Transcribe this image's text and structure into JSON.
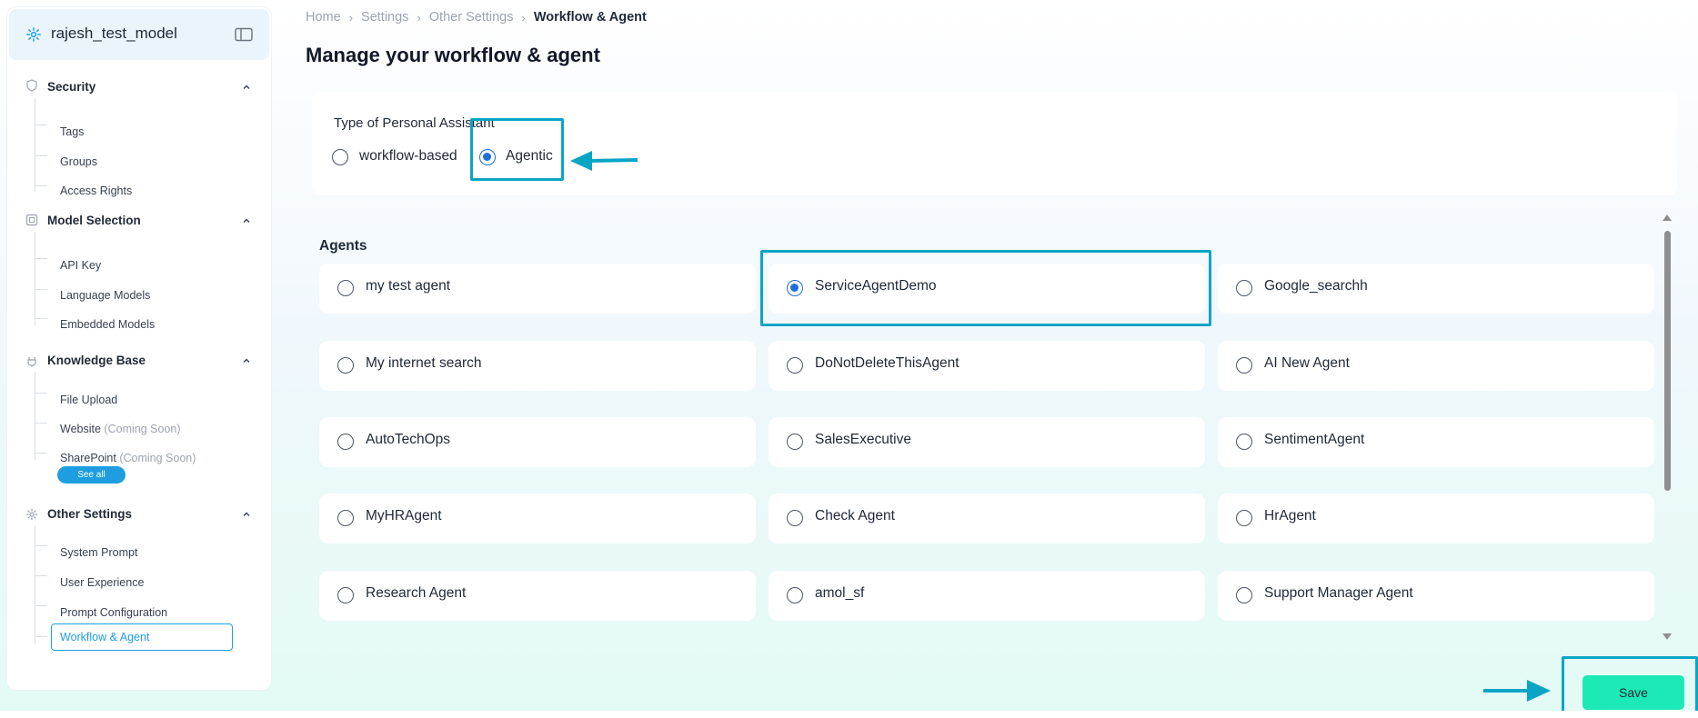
{
  "sidebar": {
    "model_name": "rajesh_test_model",
    "sections": [
      {
        "title": "Security",
        "items": [
          "Tags",
          "Groups",
          "Access Rights"
        ]
      },
      {
        "title": "Model Selection",
        "items": [
          "API Key",
          "Language Models",
          "Embedded Models"
        ]
      },
      {
        "title": "Knowledge Base",
        "items": [
          "File Upload",
          "Website",
          "SharePoint"
        ]
      },
      {
        "title": "Other Settings",
        "items": [
          "System Prompt",
          "User Experience",
          "Prompt Configuration",
          "Workflow & Agent"
        ]
      }
    ],
    "coming_soon": "(Coming Soon)",
    "see_all": "See all"
  },
  "breadcrumb": [
    "Home",
    "Settings",
    "Other Settings",
    "Workflow & Agent"
  ],
  "page_title": "Manage your workflow & agent",
  "personal_assistant": {
    "label": "Type of Personal Assistant",
    "options": [
      "workflow-based",
      "Agentic"
    ],
    "selected": "Agentic"
  },
  "agents": {
    "heading": "Agents",
    "selected": "ServiceAgentDemo",
    "list": [
      "my test agent",
      "ServiceAgentDemo",
      "Google_searchh",
      "My internet search",
      "DoNotDeleteThisAgent",
      "AI New Agent",
      "AutoTechOps",
      "SalesExecutive",
      "SentimentAgent",
      "MyHRAgent",
      "Check Agent",
      "HrAgent",
      "Research Agent",
      "amol_sf",
      "Support Manager Agent"
    ]
  },
  "save_label": "Save",
  "colors": {
    "accent": "#1e9ee0",
    "radio_selected": "#1e6fd9",
    "highlight": "#0aa5c5",
    "save": "#1de9b6"
  },
  "icons": [
    "settings-gear-icon",
    "panel-toggle-icon",
    "shield-icon",
    "chevron-up-icon",
    "square-icon",
    "plug-icon",
    "gear-icon",
    "scroll-up-icon",
    "scroll-down-icon",
    "arrow-left-icon",
    "arrow-right-icon"
  ]
}
